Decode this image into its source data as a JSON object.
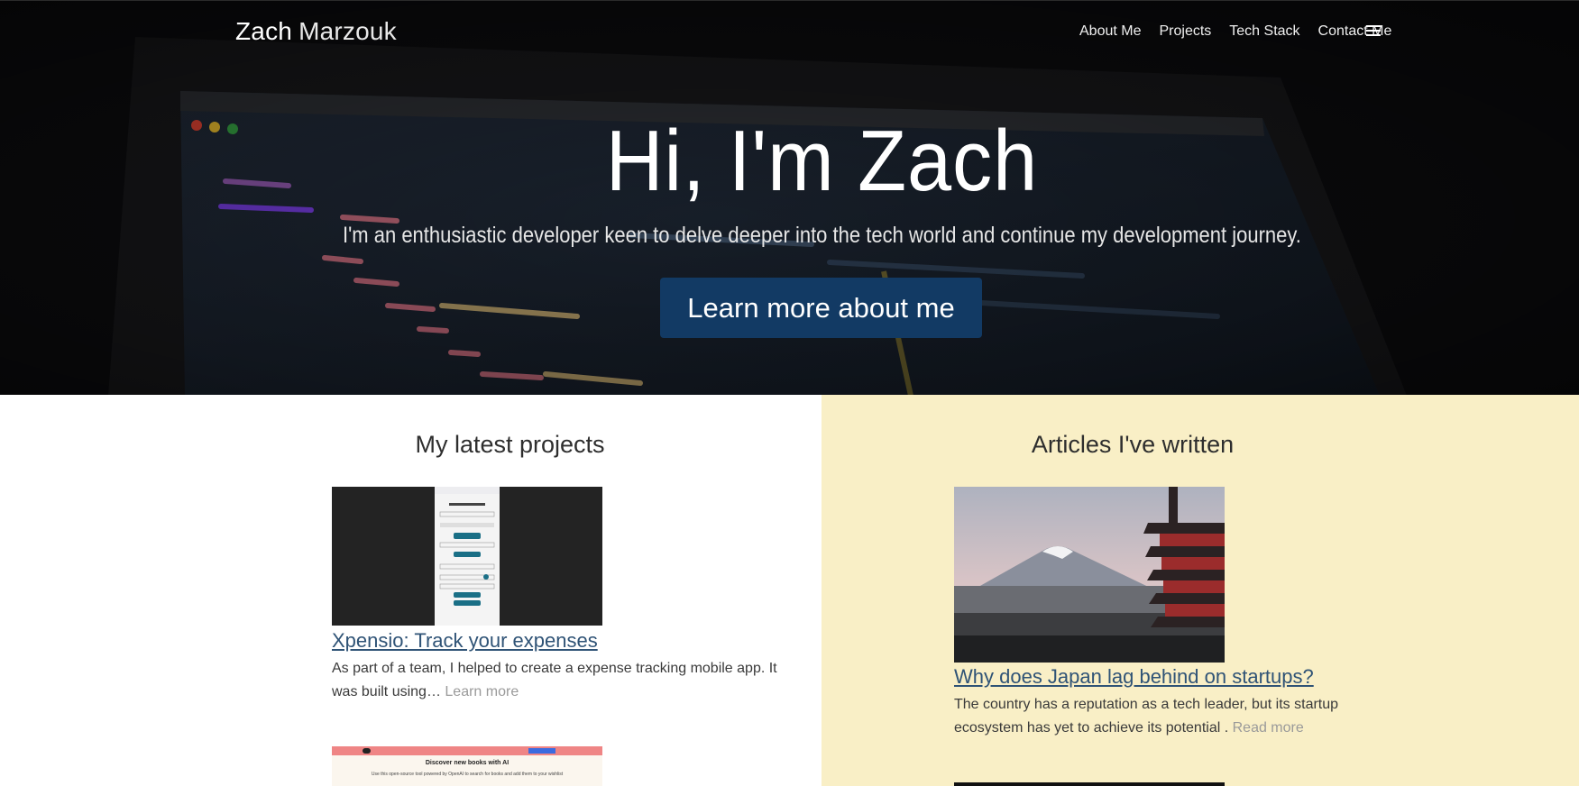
{
  "brand": {
    "first": "Zach",
    "last": "Marzouk"
  },
  "nav": {
    "items": [
      "About Me",
      "Projects",
      "Tech Stack",
      "Contact Me"
    ]
  },
  "hero": {
    "title": "Hi, I'm Zach",
    "subtitle": "I'm an enthusiastic developer keen to delve deeper into the tech world and continue my development journey.",
    "cta": "Learn more about me"
  },
  "projects": {
    "heading": "My latest projects",
    "items": [
      {
        "title": "Xpensio: Track your expenses",
        "desc": "As part of a team, I helped to create a expense tracking mobile app. It was built using…",
        "more": "Learn more"
      },
      {
        "preview_heading": "Discover new books with AI",
        "preview_text": "Use this open-source tool powered by OpenAI to search for books and add them to your wishlist"
      }
    ]
  },
  "articles": {
    "heading": "Articles I've written",
    "items": [
      {
        "title": "Why does Japan lag behind on startups?",
        "desc": "The country has a reputation as a tech leader, but its startup ecosystem has yet to achieve its potential .",
        "more": "Read more"
      }
    ]
  },
  "colors": {
    "hero_bg": "#0a0a0c",
    "cta": "#123a64",
    "articles_bg": "#f9efc6",
    "link": "#2f5376"
  }
}
